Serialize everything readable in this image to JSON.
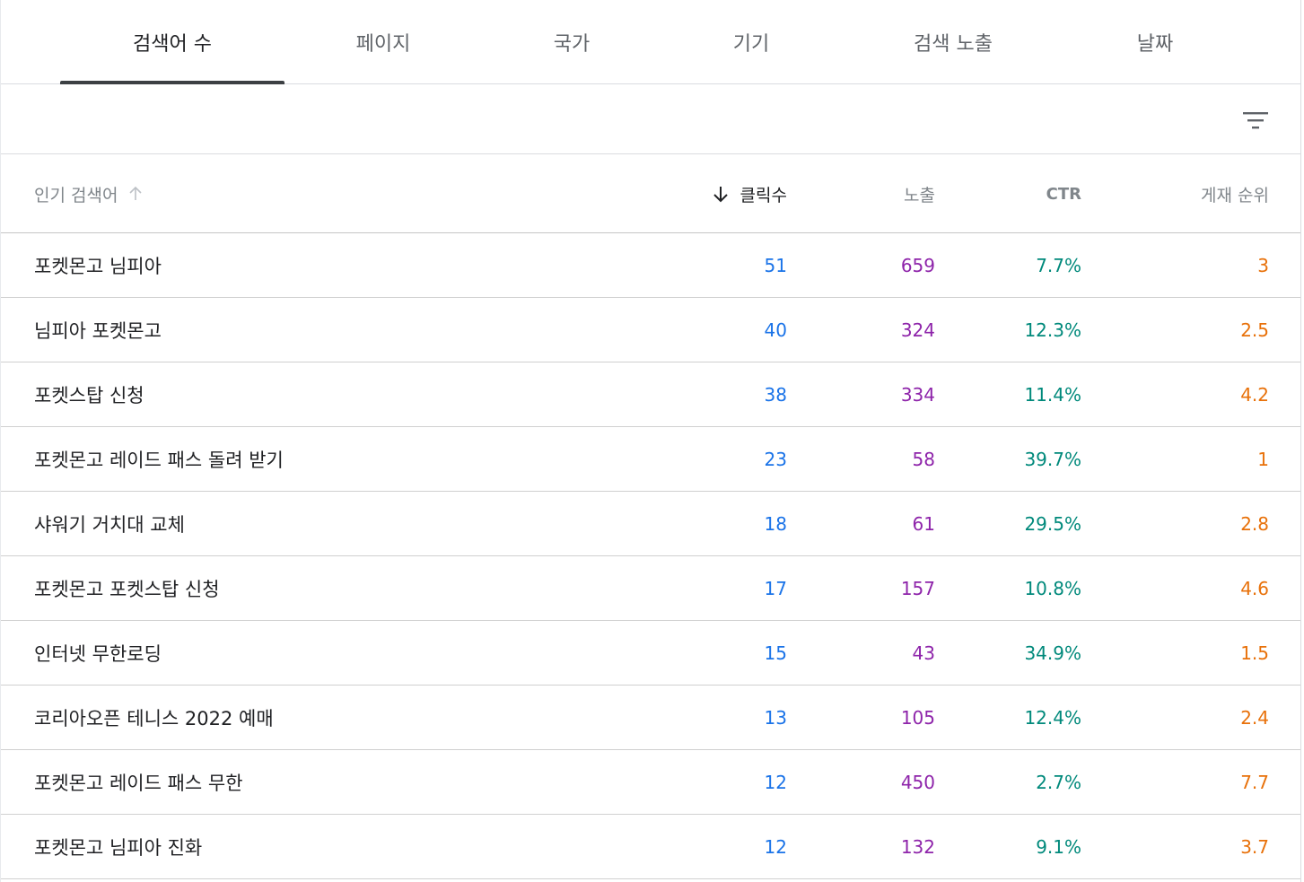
{
  "tabs": [
    {
      "label": "검색어 수",
      "active": true
    },
    {
      "label": "페이지",
      "active": false
    },
    {
      "label": "국가",
      "active": false
    },
    {
      "label": "기기",
      "active": false
    },
    {
      "label": "검색 노출",
      "active": false
    },
    {
      "label": "날짜",
      "active": false
    }
  ],
  "toolbar": {
    "filter_icon": "filter-list-icon"
  },
  "columns": {
    "query": "인기 검색어",
    "clicks": "클릭수",
    "impressions": "노출",
    "ctr": "CTR",
    "position": "게재 순위"
  },
  "colors": {
    "clicks": "#1a73e8",
    "impressions": "#8e24aa",
    "ctr": "#00897b",
    "position": "#e8710a"
  },
  "rows": [
    {
      "query": "포켓몬고 님피아",
      "clicks": "51",
      "impressions": "659",
      "ctr": "7.7%",
      "position": "3"
    },
    {
      "query": "님피아 포켓몬고",
      "clicks": "40",
      "impressions": "324",
      "ctr": "12.3%",
      "position": "2.5"
    },
    {
      "query": "포켓스탑 신청",
      "clicks": "38",
      "impressions": "334",
      "ctr": "11.4%",
      "position": "4.2"
    },
    {
      "query": "포켓몬고 레이드 패스 돌려 받기",
      "clicks": "23",
      "impressions": "58",
      "ctr": "39.7%",
      "position": "1"
    },
    {
      "query": "샤워기 거치대 교체",
      "clicks": "18",
      "impressions": "61",
      "ctr": "29.5%",
      "position": "2.8"
    },
    {
      "query": "포켓몬고 포켓스탑 신청",
      "clicks": "17",
      "impressions": "157",
      "ctr": "10.8%",
      "position": "4.6"
    },
    {
      "query": "인터넷 무한로딩",
      "clicks": "15",
      "impressions": "43",
      "ctr": "34.9%",
      "position": "1.5"
    },
    {
      "query": "코리아오픈 테니스 2022 예매",
      "clicks": "13",
      "impressions": "105",
      "ctr": "12.4%",
      "position": "2.4"
    },
    {
      "query": "포켓몬고 레이드 패스 무한",
      "clicks": "12",
      "impressions": "450",
      "ctr": "2.7%",
      "position": "7.7"
    },
    {
      "query": "포켓몬고 님피아 진화",
      "clicks": "12",
      "impressions": "132",
      "ctr": "9.1%",
      "position": "3.7"
    }
  ]
}
